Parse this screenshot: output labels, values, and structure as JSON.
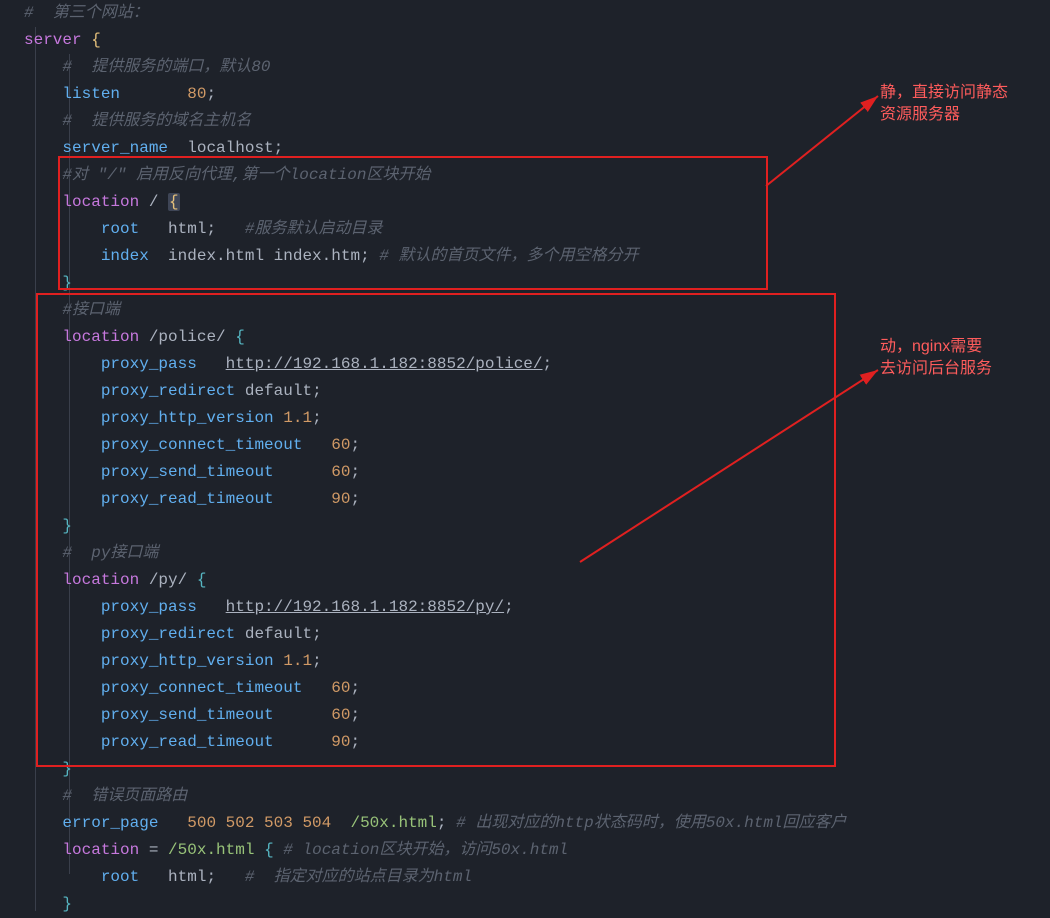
{
  "code": {
    "c1": "#  第三个网站：",
    "kw_server": "server",
    "c2": "#  提供服务的端口，默认80",
    "dir_listen": "listen",
    "listen_port": "80",
    "c3": "#  提供服务的域名主机名",
    "dir_server_name": "server_name",
    "server_name_val": "localhost",
    "c4": "#对 \"/\" 启用反向代理,第一个location区块开始",
    "kw_location": "location",
    "loc1_path": "/",
    "dir_root": "root",
    "root_val": "html",
    "c5": "#服务默认启动目录",
    "dir_index": "index",
    "index_val": "index.html index.htm",
    "c6": "# 默认的首页文件，多个用空格分开",
    "c7": "#接口端",
    "loc2_path": "/police/",
    "dir_proxy_pass": "proxy_pass",
    "police_url": "http://192.168.1.182:8852/police/",
    "dir_proxy_redirect": "proxy_redirect",
    "proxy_redirect_val": "default",
    "dir_proxy_http_version": "proxy_http_version",
    "proxy_http_version_val": "1.1",
    "dir_proxy_connect_timeout": "proxy_connect_timeout",
    "connect_timeout_val": "60",
    "dir_proxy_send_timeout": "proxy_send_timeout",
    "send_timeout_val": "60",
    "dir_proxy_read_timeout": "proxy_read_timeout",
    "read_timeout_val": "90",
    "c8": "#  py接口端",
    "loc3_path": "/py/",
    "py_url": "http://192.168.1.182:8852/py/",
    "c9": "#  错误页面路由",
    "dir_error_page": "error_page",
    "error_codes": "500 502 503 504",
    "error_page_file": "/50x.html",
    "c10": "# 出现对应的http状态码时，使用50x.html回应客户",
    "loc4_eq": "=",
    "loc4_path": "/50x.html",
    "c11": "# location区块开始，访问50x.html",
    "c12": "#  指定对应的站点目录为html"
  },
  "annot": {
    "top1": "静，直接访问静态",
    "top2": "资源服务器",
    "bot1": "动，nginx需要",
    "bot2": "去访问后台服务"
  }
}
